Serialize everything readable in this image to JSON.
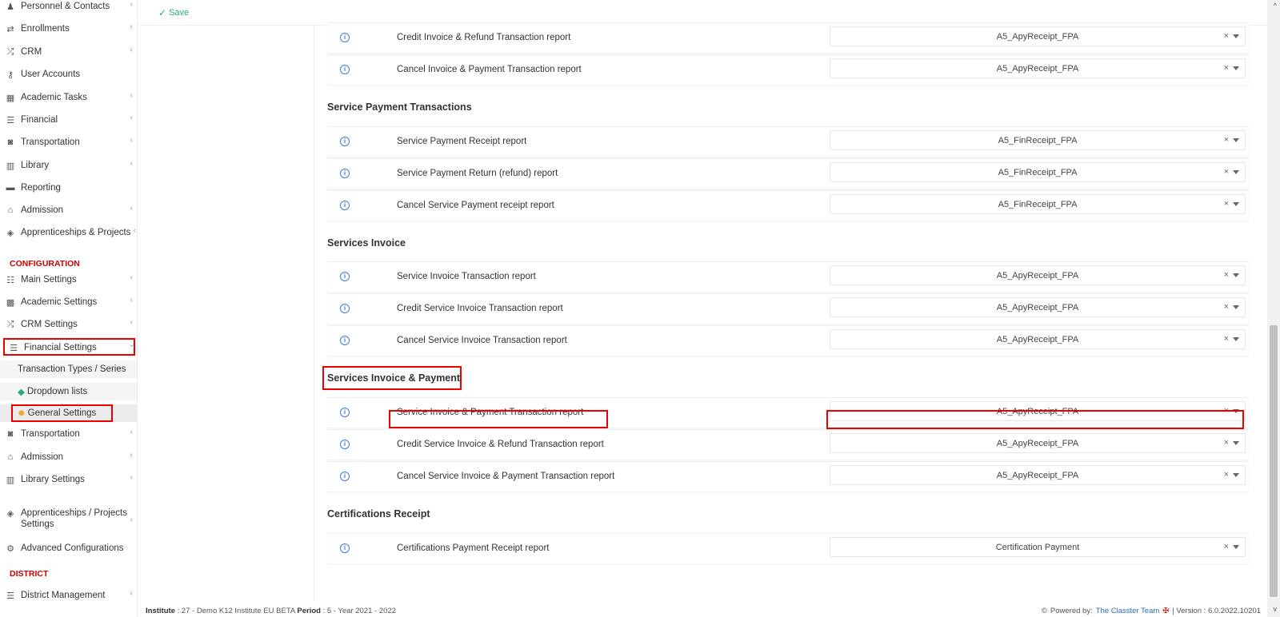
{
  "sidebar": {
    "items_top": [
      {
        "label": "Personnel & Contacts",
        "icon": "users-icon"
      },
      {
        "label": "Enrollments",
        "icon": "swap-icon"
      },
      {
        "label": "CRM",
        "icon": "shuffle-icon"
      },
      {
        "label": "User Accounts",
        "icon": "key-icon"
      },
      {
        "label": "Academic Tasks",
        "icon": "grid-icon"
      },
      {
        "label": "Financial",
        "icon": "money-icon"
      },
      {
        "label": "Transportation",
        "icon": "bus-icon"
      },
      {
        "label": "Library",
        "icon": "books-icon"
      },
      {
        "label": "Reporting",
        "icon": "print-icon"
      },
      {
        "label": "Admission",
        "icon": "institution-icon"
      },
      {
        "label": "Apprenticeships & Projects",
        "icon": "cube-icon"
      }
    ],
    "configuration_heading": "CONFIGURATION",
    "config_items": [
      {
        "label": "Main Settings",
        "icon": "sliders-icon"
      },
      {
        "label": "Academic Settings",
        "icon": "classroom-icon"
      },
      {
        "label": "CRM Settings",
        "icon": "shuffle-icon"
      },
      {
        "label": "Financial Settings",
        "icon": "money-icon"
      }
    ],
    "financial_sub": [
      {
        "label": "Transaction Types / Series"
      },
      {
        "label": "Dropdown lists"
      },
      {
        "label": "General Settings"
      }
    ],
    "config_items_after": [
      {
        "label": "Transportation",
        "icon": "bus-icon"
      },
      {
        "label": "Admission",
        "icon": "institution-icon"
      },
      {
        "label": "Library Settings",
        "icon": "books-icon"
      },
      {
        "label": "Apprenticeships / Projects Settings",
        "icon": "cube-icon"
      },
      {
        "label": "Advanced Configurations",
        "icon": "gears-icon"
      }
    ],
    "district_heading": "DISTRICT",
    "district_items": [
      {
        "label": "District Management",
        "icon": "menu-icon"
      }
    ]
  },
  "toolbar": {
    "save_label": "Save"
  },
  "sections": [
    {
      "title": "",
      "rows": [
        {
          "label": "Credit Invoice & Refund Transaction report",
          "value": "A5_ApyReceipt_FPA"
        },
        {
          "label": "Cancel Invoice & Payment Transaction report",
          "value": "A5_ApyReceipt_FPA"
        }
      ]
    },
    {
      "title": "Service Payment Transactions",
      "rows": [
        {
          "label": "Service Payment Receipt report",
          "value": "A5_FinReceipt_FPA"
        },
        {
          "label": "Service Payment Return (refund) report",
          "value": "A5_FinReceipt_FPA"
        },
        {
          "label": "Cancel Service Payment receipt report",
          "value": "A5_FinReceipt_FPA"
        }
      ]
    },
    {
      "title": "Services Invoice",
      "rows": [
        {
          "label": "Service Invoice Transaction report",
          "value": "A5_ApyReceipt_FPA"
        },
        {
          "label": "Credit Service Invoice Transaction report",
          "value": "A5_ApyReceipt_FPA"
        },
        {
          "label": "Cancel Service Invoice Transaction report",
          "value": "A5_ApyReceipt_FPA"
        }
      ]
    },
    {
      "title": "Services Invoice & Payment",
      "rows": [
        {
          "label": "Service Invoice & Payment Transaction report",
          "value": "A5_ApyReceipt_FPA"
        },
        {
          "label": "Credit Service Invoice & Refund Transaction report",
          "value": "A5_ApyReceipt_FPA"
        },
        {
          "label": "Cancel Service Invoice & Payment Transaction report",
          "value": "A5_ApyReceipt_FPA"
        }
      ]
    },
    {
      "title": "Certifications Receipt",
      "rows": [
        {
          "label": "Certifications Payment Receipt report",
          "value": "Certification Payment"
        }
      ]
    }
  ],
  "select_clear_symbol": "×",
  "info_symbol": "i",
  "footer": {
    "institute_label": "Institute",
    "institute_value": ": 27 - Demo K12 Institute EU BETA",
    "period_label": "Period",
    "period_value": ": 5 - Year 2021 - 2022",
    "powered_by": "Powered by:",
    "team_link": "The Classter Team",
    "version": "| Version : 6.0.2022.10201"
  },
  "colors": {
    "accent_red": "#e00000",
    "save_green": "#2ca87f",
    "info_blue": "#3c7bd6"
  }
}
